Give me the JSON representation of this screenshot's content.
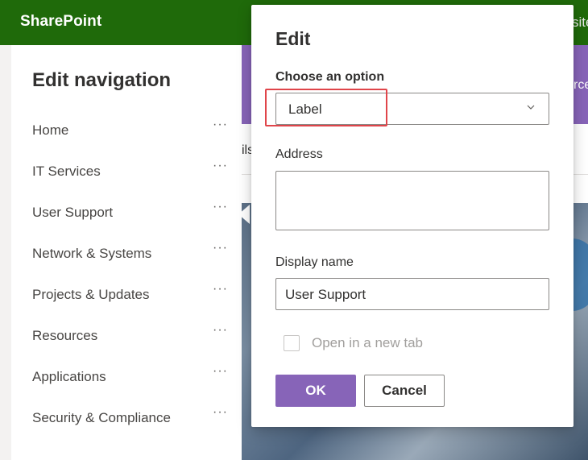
{
  "suite_bar": {
    "brand": "SharePoint",
    "partial_text": "site"
  },
  "background": {
    "partial_text_left": "ils",
    "partial_text_banner": "rce"
  },
  "nav_panel": {
    "title": "Edit navigation",
    "more_glyph": "···",
    "items": [
      {
        "label": "Home"
      },
      {
        "label": "IT Services"
      },
      {
        "label": "User Support"
      },
      {
        "label": "Network & Systems"
      },
      {
        "label": "Projects & Updates"
      },
      {
        "label": "Resources"
      },
      {
        "label": "Applications"
      },
      {
        "label": "Security & Compliance"
      }
    ]
  },
  "dialog": {
    "title": "Edit",
    "choose_option_label": "Choose an option",
    "choose_option_value": "Label",
    "address_label": "Address",
    "address_value": "",
    "display_name_label": "Display name",
    "display_name_value": "User Support",
    "open_new_tab_label": "Open in a new tab",
    "open_new_tab_checked": false,
    "ok_label": "OK",
    "cancel_label": "Cancel"
  },
  "icons": {
    "dropdown": "chevron-down-icon",
    "more": "more-options-icon",
    "resize": "resize-grip-icon"
  },
  "colors": {
    "suite_bar": "#1f6a0a",
    "accent": "#8764b8",
    "highlight": "#e0454a"
  }
}
